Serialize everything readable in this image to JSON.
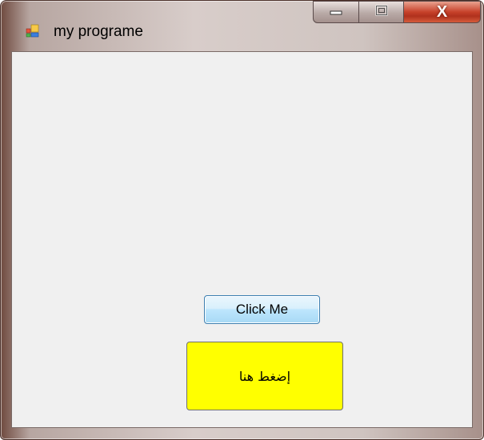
{
  "window": {
    "title": "my programe",
    "app_icon": "windows-app-icon",
    "controls": {
      "minimize_icon": "minimize-icon",
      "maximize_icon": "maximize-icon",
      "close_label": "X"
    }
  },
  "form": {
    "click_button_label": "Click Me",
    "arabic_button_label": "إضغط هنا",
    "arabic_button_color": "#ffff00"
  }
}
